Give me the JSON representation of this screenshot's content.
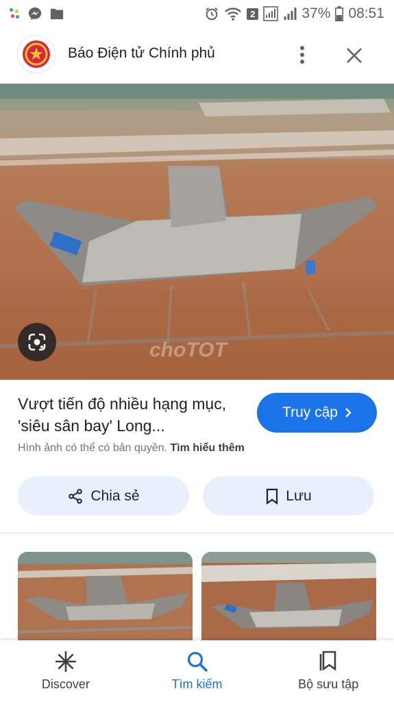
{
  "status_bar": {
    "battery_percent": "37%",
    "time": "08:51",
    "sim_badge": "2",
    "icons": [
      "app-dots-icon",
      "messenger-icon",
      "folder-icon",
      "alarm-icon",
      "wifi-icon",
      "signal-icon",
      "signal-icon",
      "battery-icon"
    ]
  },
  "header": {
    "site_name": "Báo Điện tử Chính phủ",
    "logo_icon": "national-emblem-icon",
    "menu_icon": "more-vert-icon",
    "close_icon": "close-icon"
  },
  "image": {
    "watermark": "choTOT",
    "lens_icon": "google-lens-icon"
  },
  "result": {
    "title": "Vượt tiến độ nhiều hạng mục, 'siêu sân bay' Long...",
    "visit_label": "Truy cập",
    "visit_icon": "chevron-right-icon",
    "copyright_text": "Hình ảnh có thể có bản quyền.",
    "learn_more": "Tìm hiểu thêm"
  },
  "actions": {
    "share_label": "Chia sẻ",
    "share_icon": "share-icon",
    "save_label": "Lưu",
    "save_icon": "bookmark-icon"
  },
  "bottom_nav": {
    "items": [
      {
        "label": "Discover",
        "icon": "asterisk-icon",
        "active": false
      },
      {
        "label": "Tìm kiếm",
        "icon": "search-icon",
        "active": true
      },
      {
        "label": "Bộ sưu tập",
        "icon": "collections-icon",
        "active": false
      }
    ]
  },
  "colors": {
    "accent": "#1a73e8",
    "chip_bg": "#e8f0fe",
    "secondary_text": "#70757a"
  }
}
